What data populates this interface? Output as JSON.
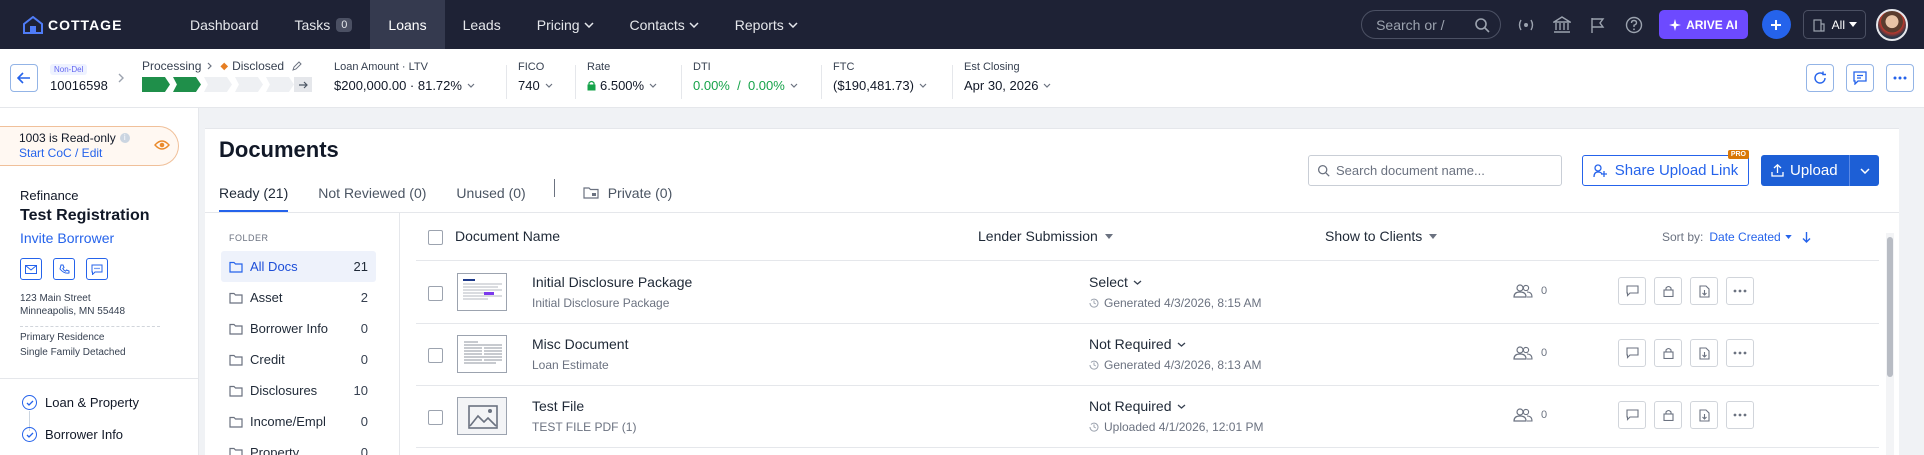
{
  "brand": {
    "name": "COTTAGE"
  },
  "nav": {
    "dashboard": "Dashboard",
    "tasks": "Tasks",
    "tasks_count": "0",
    "loans": "Loans",
    "leads": "Leads",
    "pricing": "Pricing",
    "contacts": "Contacts",
    "reports": "Reports",
    "search_placeholder": "Search or /",
    "arive_ai": "ARIVE AI",
    "scope": "All"
  },
  "loan": {
    "badge": "Non-Del",
    "number": "10016598",
    "stage": "Processing",
    "substage": "Disclosed",
    "progress_steps_done": 2,
    "progress_steps_total": 5,
    "amount_label": "Loan Amount",
    "ltv_label": "LTV",
    "amount": "$200,000.00",
    "ltv": "81.72%",
    "fico_label": "FICO",
    "fico": "740",
    "rate_label": "Rate",
    "rate": "6.500%",
    "dti_label": "DTI",
    "dti_front": "0.00%",
    "dti_sep": "/",
    "dti_back": "0.00%",
    "ftc_label": "FTC",
    "ftc": "($190,481.73)",
    "closing_label": "Est Closing",
    "closing": "Apr 30, 2026"
  },
  "sidebar": {
    "readonly_title": "1003 is Read-only",
    "readonly_link": "Start CoC / Edit",
    "purpose": "Refinance",
    "borrower_name": "Test Registration",
    "invite": "Invite Borrower",
    "address_line1": "123 Main Street",
    "address_line2": "Minneapolis, MN 55448",
    "occupancy": "Primary Residence",
    "property_type": "Single Family Detached",
    "nav": [
      "Loan & Property",
      "Borrower Info"
    ]
  },
  "documents": {
    "title": "Documents",
    "tabs": {
      "ready": "Ready (21)",
      "not_reviewed": "Not Reviewed (0)",
      "unused": "Unused (0)",
      "private": "Private (0)"
    },
    "search_placeholder": "Search document name...",
    "share_label": "Share Upload Link",
    "pro_badge": "PRO",
    "upload_label": "Upload",
    "folder_header": "FOLDER",
    "folders": [
      {
        "name": "All Docs",
        "count": "21"
      },
      {
        "name": "Asset",
        "count": "2"
      },
      {
        "name": "Borrower Info",
        "count": "0"
      },
      {
        "name": "Credit",
        "count": "0"
      },
      {
        "name": "Disclosures",
        "count": "10"
      },
      {
        "name": "Income/Empl",
        "count": "0"
      },
      {
        "name": "Property",
        "count": "0"
      }
    ],
    "columns": {
      "name": "Document Name",
      "lender": "Lender Submission",
      "clients": "Show to Clients",
      "sort_by": "Sort by:",
      "sort_value": "Date Created"
    },
    "rows": [
      {
        "name": "Initial Disclosure Package",
        "sub": "Initial Disclosure Package",
        "status": "Select",
        "meta": "Generated 4/3/2026, 8:15 AM",
        "clients": "0"
      },
      {
        "name": "Misc Document",
        "sub": "Loan Estimate",
        "status": "Not Required",
        "meta": "Generated 4/3/2026, 8:13 AM",
        "clients": "0"
      },
      {
        "name": "Test File",
        "sub": "TEST FILE PDF (1)",
        "status": "Not Required",
        "meta": "Uploaded 4/1/2026, 12:01 PM",
        "clients": "0"
      }
    ]
  },
  "colors": {
    "nav_bg": "#1e2235",
    "accent": "#2563eb",
    "arive": "#6d4aff",
    "progress_done": "#1f8f4a",
    "positive": "#16a34a"
  }
}
